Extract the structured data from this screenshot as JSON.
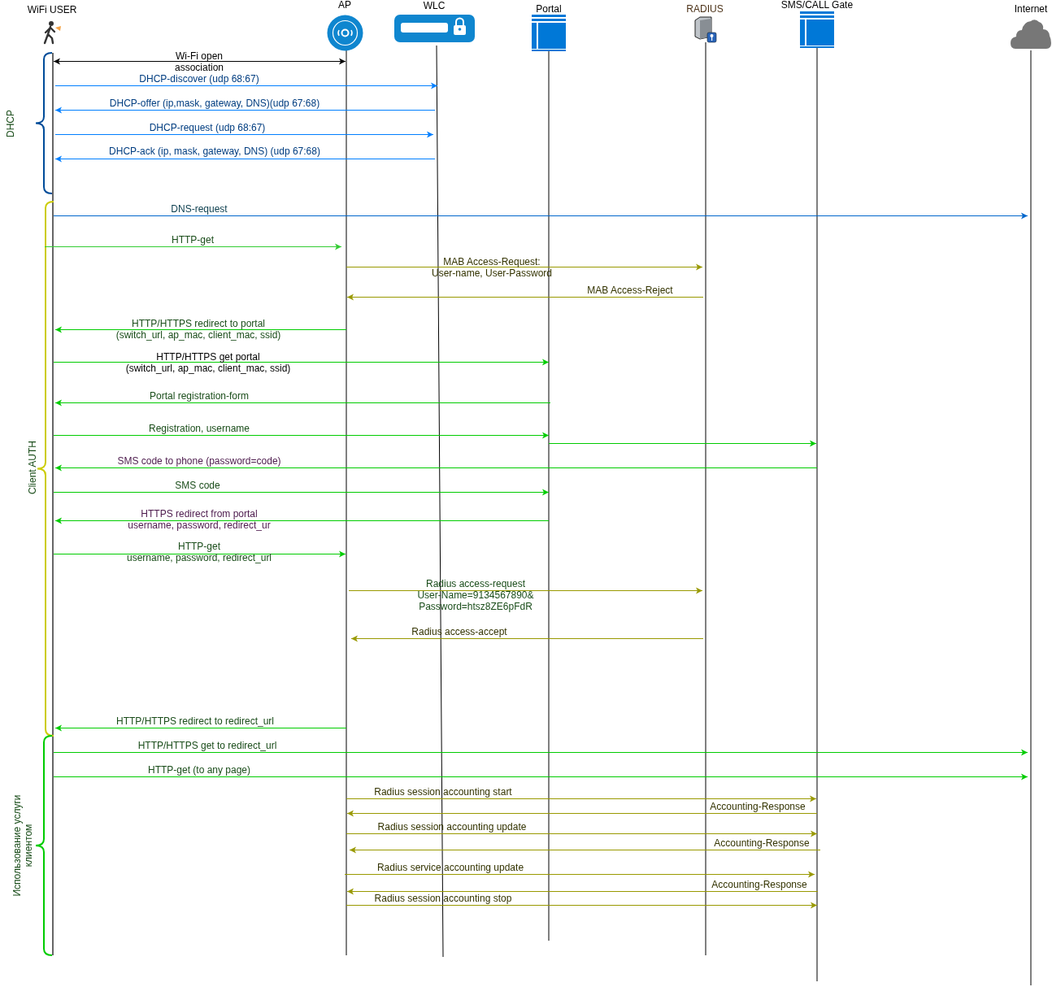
{
  "participants": [
    {
      "label": "WiFi USER",
      "kind": "user"
    },
    {
      "label": "AP",
      "kind": "access-point"
    },
    {
      "label": "WLC",
      "kind": "controller"
    },
    {
      "label": "Portal",
      "kind": "window"
    },
    {
      "label": "RADIUS",
      "kind": "server"
    },
    {
      "label": "SMS/CALL Gate",
      "kind": "window"
    },
    {
      "label": "Internet",
      "kind": "cloud"
    }
  ],
  "groups": [
    {
      "lines": [
        "DHCP"
      ],
      "color": "#004c99"
    },
    {
      "lines": [
        "Client AUTH"
      ],
      "color": "#cccc00"
    },
    {
      "lines": [
        "Использование услуги",
        "клиентом"
      ],
      "color": "#00cc00"
    }
  ],
  "messages": [
    {
      "label": {
        "lines": [
          "Wi-Fi open",
          "association"
        ],
        "color": "#000000"
      },
      "arrow_start": true,
      "arrow_end": true,
      "color": "#000000"
    },
    {
      "label": {
        "lines": [
          "DHCP-discover (udp 68:67)"
        ],
        "color": "#003d80"
      },
      "arrow_start": false,
      "arrow_end": true,
      "color": "#007fff"
    },
    {
      "label": {
        "lines": [
          "DHCP-offer (ip,mask, gateway, DNS)(udp 67:68)"
        ],
        "color": "#003d80"
      },
      "arrow_start": true,
      "arrow_end": false,
      "color": "#007fff"
    },
    {
      "label": {
        "lines": [
          "DHCP-request (udp 68:67)"
        ],
        "color": "#003d80"
      },
      "arrow_start": false,
      "arrow_end": true,
      "color": "#007fff"
    },
    {
      "label": {
        "lines": [
          "DHCP-ack (ip, mask, gateway, DNS) (udp 67:68)"
        ],
        "color": "#003d80"
      },
      "arrow_start": true,
      "arrow_end": false,
      "color": "#007fff"
    },
    {
      "label": {
        "lines": [
          "DNS-request"
        ],
        "color": "#0a3d4d"
      },
      "arrow_start": false,
      "arrow_end": true,
      "color": "#0066cc"
    },
    {
      "label": {
        "lines": [
          "HTTP-get"
        ],
        "color": "#1a4d1a"
      },
      "arrow_start": false,
      "arrow_end": true,
      "color": "#33cc33"
    },
    {
      "label": {
        "lines": [
          "MAB Access-Request:",
          "User-name, User-Password"
        ],
        "color": "#333300"
      },
      "arrow_start": false,
      "arrow_end": true,
      "color": "#999900"
    },
    {
      "label": {
        "lines": [
          "MAB Access-Reject"
        ],
        "color": "#333300"
      },
      "arrow_start": true,
      "arrow_end": false,
      "color": "#999900"
    },
    {
      "label": {
        "lines": [
          "HTTP/HTTPS redirect to portal",
          "(switch_url, ap_mac, client_mac, ssid)"
        ],
        "color": "#1a4d1a"
      },
      "arrow_start": true,
      "arrow_end": false,
      "color": "#00cc00"
    },
    {
      "label": {
        "lines": [
          "HTTP/HTTPS get portal",
          "(switch_url, ap_mac, client_mac, ssid)"
        ],
        "color": "#000000"
      },
      "arrow_start": false,
      "arrow_end": true,
      "color": "#00cc00"
    },
    {
      "label": {
        "lines": [
          "Portal registration-form"
        ],
        "color": "#1a4d1a"
      },
      "arrow_start": true,
      "arrow_end": false,
      "color": "#00cc00"
    },
    {
      "label": {
        "lines": [
          "Registration, username"
        ],
        "color": "#1a4d1a"
      },
      "arrow_start": false,
      "arrow_end": true,
      "color": "#00cc00"
    },
    {
      "arrow_start": false,
      "arrow_end": true,
      "color": "#00cc00"
    },
    {
      "label": {
        "lines": [
          "SMS code to phone (password=code)"
        ],
        "color": "#4c1a4c"
      },
      "arrow_start": true,
      "arrow_end": false,
      "color": "#00cc00"
    },
    {
      "label": {
        "lines": [
          "SMS code"
        ],
        "color": "#1a4d1a"
      },
      "arrow_start": false,
      "arrow_end": true,
      "color": "#00cc00"
    },
    {
      "label": {
        "lines": [
          "HTTPS  redirect from portal",
          "username, password, redirect_ur"
        ],
        "color": "#4c1a4c"
      },
      "arrow_start": true,
      "arrow_end": false,
      "color": "#00cc00"
    },
    {
      "label": {
        "lines": [
          "HTTP-get",
          "username, password, redirect_url"
        ],
        "color": "#1a4d1a"
      },
      "arrow_start": false,
      "arrow_end": true,
      "color": "#00cc00"
    },
    {
      "label": {
        "lines": [
          "Radius access-request",
          "User-Name=9134567890&",
          "Password=htsz8ZE6pFdR"
        ],
        "color": "#1a4d1a"
      },
      "arrow_start": false,
      "arrow_end": true,
      "color": "#999900"
    },
    {
      "label": {
        "lines": [
          "Radius access-accept"
        ],
        "color": "#333300"
      },
      "arrow_start": true,
      "arrow_end": false,
      "color": "#999900"
    },
    {
      "label": {
        "lines": [
          "HTTP/HTTPS redirect to redirect_url"
        ],
        "color": "#1a4d1a"
      },
      "arrow_start": true,
      "arrow_end": false,
      "color": "#00cc00"
    },
    {
      "label": {
        "lines": [
          "HTTP/HTTPS get to redirect_url"
        ],
        "color": "#1a4d1a"
      },
      "arrow_start": false,
      "arrow_end": true,
      "color": "#00cc00"
    },
    {
      "label": {
        "lines": [
          "HTTP-get (to any page)"
        ],
        "color": "#1a4d1a"
      },
      "arrow_start": false,
      "arrow_end": true,
      "color": "#00cc00"
    },
    {
      "label": {
        "lines": [
          "Radius session accounting start"
        ],
        "color": "#333300"
      },
      "arrow_start": false,
      "arrow_end": true,
      "color": "#999900"
    },
    {
      "label": {
        "lines": [
          "Accounting-Response"
        ],
        "color": "#333300"
      },
      "arrow_start": true,
      "arrow_end": false,
      "color": "#999900"
    },
    {
      "label": {
        "lines": [
          "Radius session accounting update"
        ],
        "color": "#333300"
      },
      "arrow_start": false,
      "arrow_end": true,
      "color": "#999900"
    },
    {
      "label": {
        "lines": [
          "Accounting-Response"
        ],
        "color": "#333300"
      },
      "arrow_start": true,
      "arrow_end": false,
      "color": "#999900"
    },
    {
      "label": {
        "lines": [
          "Radius service accounting update"
        ],
        "color": "#333300"
      },
      "arrow_start": false,
      "arrow_end": true,
      "color": "#999900"
    },
    {
      "label": {
        "lines": [
          "Accounting-Response"
        ],
        "color": "#333300"
      },
      "arrow_start": true,
      "arrow_end": false,
      "color": "#999900"
    },
    {
      "label": {
        "lines": [
          "Radius session accounting stop"
        ],
        "color": "#333300"
      },
      "arrow_start": false,
      "arrow_end": true,
      "color": "#999900"
    }
  ]
}
